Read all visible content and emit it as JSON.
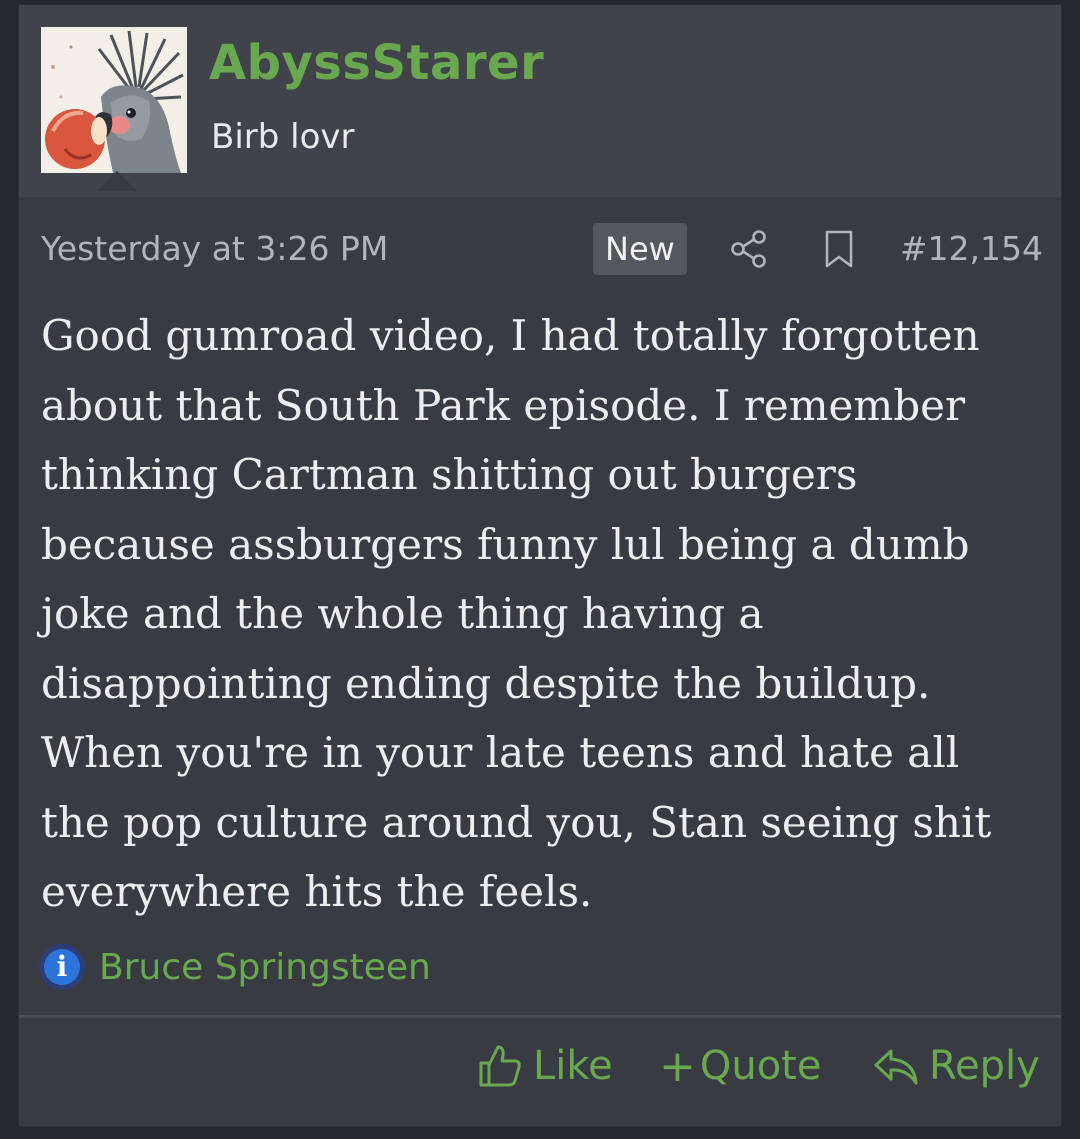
{
  "post": {
    "username": "AbyssStarer",
    "user_title": "Birb lovr",
    "timestamp": "Yesterday at 3:26 PM",
    "badge": "New",
    "post_number": "#12,154",
    "message": "Good gumroad video, I had totally forgotten about that South Park episode. I remember thinking Cartman shitting out burgers because assburgers funny lul being a dumb joke and the whole thing having a disappointing ending despite the buildup. When you're in your late teens and hate all the pop culture around you, Stan seeing shit everywhere hits the feels.",
    "signature": "Bruce Springsteen",
    "actions": {
      "like": "Like",
      "quote_prefix": "+",
      "quote": "Quote",
      "reply": "Reply"
    }
  },
  "icons": {
    "avatar": "cockatoo-avatar",
    "share": "share-icon",
    "bookmark": "bookmark-icon",
    "info": "info-icon",
    "like": "thumbs-up-icon",
    "reply": "reply-icon"
  },
  "colors": {
    "accent": "#6aa84f",
    "post_bg": "#393b43",
    "header_bg": "#41434b",
    "text": "#ededee",
    "muted": "#b3b4b8"
  }
}
